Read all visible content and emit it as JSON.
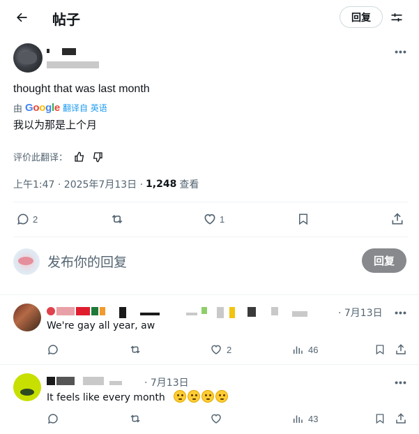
{
  "header": {
    "title": "帖子",
    "reply_button": "回复"
  },
  "post": {
    "text": "thought that was last month",
    "translate": {
      "prefix": "由",
      "provider": "Google",
      "link": "翻译自 英语"
    },
    "translated_text": "我以为那是上个月",
    "rate_label": "评价此翻译：",
    "timestamp": "上午1:47 · 2025年7月13日 ·",
    "views_count": "1,248",
    "views_label": "查看",
    "actions": {
      "replies": "2",
      "retweets": "",
      "likes": "1"
    }
  },
  "compose": {
    "placeholder": "发布你的回复",
    "button": "回复"
  },
  "replies": [
    {
      "date": "· 7月13日",
      "text": "We're gay all year, aw",
      "actions": {
        "replies": "",
        "retweets": "",
        "likes": "2",
        "views": "46"
      }
    },
    {
      "date": "· 7月13日",
      "text": "It feels like every month",
      "actions": {
        "replies": "",
        "retweets": "",
        "likes": "",
        "views": "43"
      }
    }
  ],
  "colors": {
    "accent": "#1d9bf0",
    "muted": "#536471",
    "disabled_button": "#87898c"
  }
}
